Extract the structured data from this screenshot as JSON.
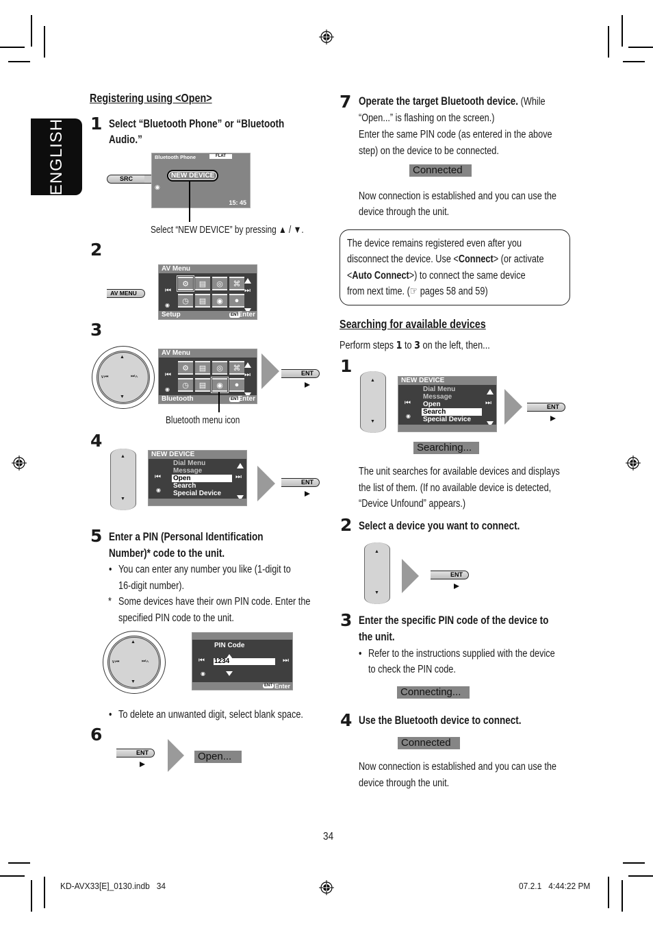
{
  "language_tab": "ENGLISH",
  "left": {
    "section_title": "Registering using <Open>",
    "step1": {
      "num": "1",
      "title_l1": "Select “Bluetooth Phone” or “Bluetooth",
      "title_l2": "Audio.”",
      "src_button": "SRC",
      "lcd": {
        "title": "Bluetooth Phone",
        "badge": "FLAT",
        "new_device": "NEW DEVICE",
        "time": "15: 45"
      },
      "callout": "Select “NEW DEVICE” by pressing ▲ / ▼."
    },
    "step2": {
      "num": "2",
      "av_menu_button": "AV MENU",
      "lcd": {
        "title": "AV Menu",
        "footer_left": "Setup",
        "ent_badge": "ENT",
        "footer_right": "Enter"
      }
    },
    "step3": {
      "num": "3",
      "lcd": {
        "title": "AV Menu",
        "footer_left": "Bluetooth",
        "ent_badge": "ENT",
        "footer_right": "Enter"
      },
      "ent_button": "ENT",
      "callout": "Bluetooth menu icon"
    },
    "step4": {
      "num": "4",
      "lcd": {
        "title": "NEW DEVICE",
        "items": [
          "Dial Menu",
          "Message",
          "Open",
          "Search",
          "Special Device"
        ],
        "selected": "Open"
      },
      "ent_button": "ENT"
    },
    "step5": {
      "num": "5",
      "title_l1": "Enter a PIN (Personal Identification",
      "title_l2": "Number)* code to the unit.",
      "bullet1_l1": "You can enter any number you like (1-digit to",
      "bullet1_l2": "16-digit number).",
      "note_l1": "Some devices have their own PIN code. Enter the",
      "note_l2": "specified PIN code to the unit.",
      "lcd": {
        "label": "PIN Code",
        "value": "1234",
        "ent_badge": "ENT",
        "footer_right": "Enter"
      },
      "bullet2": "To delete an unwanted digit, select blank space."
    },
    "step6": {
      "num": "6",
      "ent_button": "ENT",
      "status": "Open..."
    }
  },
  "right": {
    "step7": {
      "num": "7",
      "title_bold": "Operate the target Bluetooth device.",
      "title_rest": " (While",
      "l2": "“Open...” is flashing on the screen.)",
      "l3": "Enter the same PIN code (as entered in the above",
      "l4": "step) on the device to be connected.",
      "status": "Connected",
      "after_l1": "Now connection is established and you can use the",
      "after_l2": "device through the unit."
    },
    "note": {
      "l1": "The device remains registered even after you",
      "l2a": "disconnect the device. Use <",
      "l2b": "Connect",
      "l2c": "> (or activate",
      "l3a": "<",
      "l3b": "Auto Connect",
      "l3c": ">) to connect the same device",
      "l4": "from next time. (☞ pages 58 and 59)"
    },
    "search": {
      "title": "Searching for available devices",
      "intro_a": "Perform steps ",
      "intro_b": "1",
      "intro_c": " to ",
      "intro_d": "3",
      "intro_e": " on the left, then...",
      "step1": {
        "num": "1",
        "lcd": {
          "title": "NEW DEVICE",
          "items": [
            "Dial Menu",
            "Message",
            "Open",
            "Search",
            "Special Device"
          ],
          "selected": "Search"
        },
        "ent_button": "ENT",
        "status": "Searching...",
        "desc_l1": "The unit searches for available devices and displays",
        "desc_l2": "the list of them. (If no available device is detected,",
        "desc_l3": "“Device Unfound” appears.)"
      },
      "step2": {
        "num": "2",
        "title": "Select a device you want to connect.",
        "ent_button": "ENT"
      },
      "step3": {
        "num": "3",
        "title_l1": "Enter the specific PIN code of the device to",
        "title_l2": "the unit.",
        "bullet_l1": "Refer to the instructions supplied with the device",
        "bullet_l2": "to check the PIN code.",
        "status": "Connecting..."
      },
      "step4": {
        "num": "4",
        "title": "Use the Bluetooth device to connect.",
        "status": "Connected",
        "after_l1": "Now connection is established and you can use the",
        "after_l2": "device through the unit."
      }
    }
  },
  "page_number": "34",
  "footer": {
    "file": "KD-AVX33[E]_0130.indb   34",
    "datetime": "07.2.1   4:44:22 PM"
  }
}
